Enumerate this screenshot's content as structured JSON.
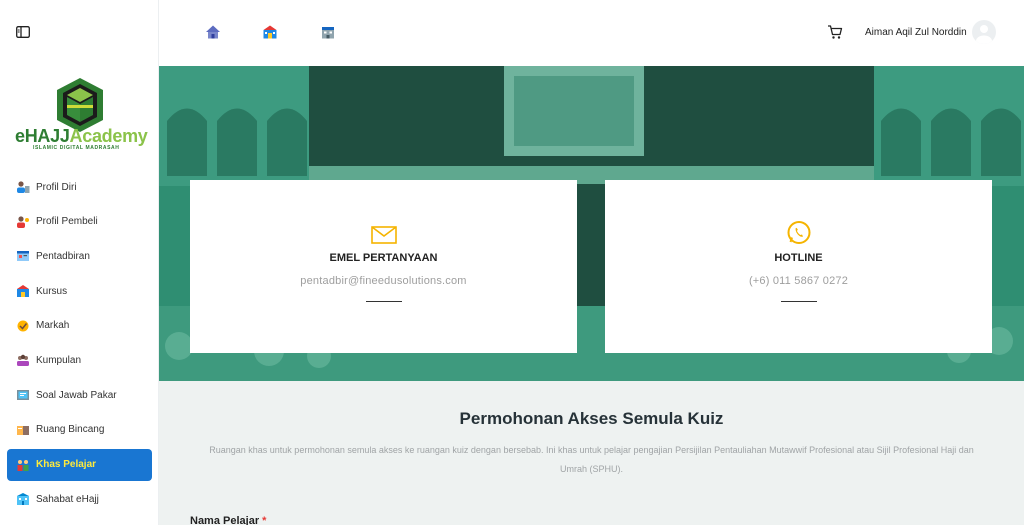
{
  "sidebar": {
    "logo_brand_e": "e",
    "logo_brand_hajj": "HAJJ",
    "logo_brand_academy": "Academy",
    "logo_tagline": "ISLAMIC DIGITAL MADRASAH",
    "items": [
      {
        "label": "Profil Diri",
        "icon": "user-profile-icon"
      },
      {
        "label": "Profil Pembeli",
        "icon": "buyer-profile-icon"
      },
      {
        "label": "Pentadbiran",
        "icon": "administration-icon"
      },
      {
        "label": "Kursus",
        "icon": "course-icon"
      },
      {
        "label": "Markah",
        "icon": "grades-icon"
      },
      {
        "label": "Kumpulan",
        "icon": "group-icon"
      },
      {
        "label": "Soal Jawab Pakar",
        "icon": "expert-qa-icon"
      },
      {
        "label": "Ruang Bincang",
        "icon": "discussion-icon"
      },
      {
        "label": "Khas Pelajar",
        "icon": "student-special-icon",
        "active": true
      },
      {
        "label": "Sahabat eHajj",
        "icon": "friends-icon"
      }
    ]
  },
  "header": {
    "user_name": "Aiman Aqil Zul Norddin",
    "icons": [
      "home-icon",
      "school-icon",
      "building-icon",
      "cart-icon"
    ]
  },
  "contact": {
    "email_title": "EMEL PERTANYAAN",
    "email_value": "pentadbir@fineedusolutions.com",
    "hotline_title": "HOTLINE",
    "hotline_value": "(+6) 011 5867 0272"
  },
  "page": {
    "title": "Permohonan Akses Semula Kuiz",
    "description": "Ruangan khas untuk permohonan semula akses ke ruangan kuiz dengan bersebab. Ini khas untuk pelajar pengajian Persijilan Pentauliahan Mutawwif Profesional atau Sijil Profesional Haji dan Umrah (SPHU).",
    "field_label": "Nama Pelajar",
    "required_mark": "*"
  },
  "colors": {
    "accent": "#1976d2",
    "active_text": "#ffeb3b",
    "hero_green": "#2f8e72",
    "icon_orange": "#f5b400"
  }
}
